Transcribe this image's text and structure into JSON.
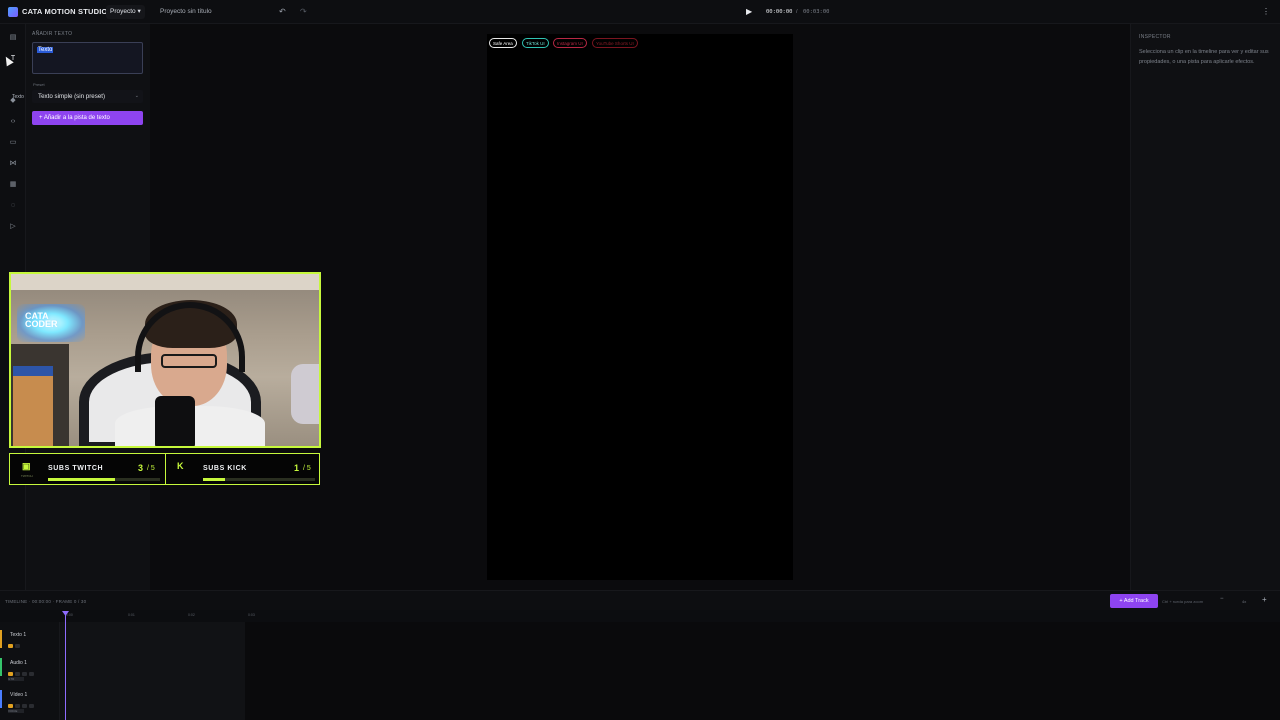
{
  "app": {
    "title": "CATA MOTION STUDIO"
  },
  "menu": {
    "proyecto": "Proyecto ▾",
    "project_name": "Proyecto sin título"
  },
  "transport": {
    "time_current": "00:00:00",
    "sep": "/",
    "time_total": "00:03:00"
  },
  "left_panel": {
    "heading": "AÑADIR TEXTO",
    "text_value": "Texto",
    "tooltip": "Texto",
    "preset_label": "Preset",
    "preset_value": "Texto simple (sin preset)",
    "add_button": "+ Añadir a la pista de texto"
  },
  "canvas": {
    "pills": [
      "Safe Area",
      "TikTok UI",
      "Instagram UI",
      "YouTube Shorts UI"
    ]
  },
  "webcam": {
    "sign_text": "CATA\nCODER"
  },
  "subs": {
    "twitch": {
      "label": "SUBS TWITCH",
      "count": "3",
      "total": "/ 5",
      "progress": 0.6
    },
    "kick": {
      "label": "SUBS KICK",
      "count": "1",
      "total": "/ 5",
      "progress": 0.2
    }
  },
  "inspector": {
    "title": "INSPECTOR",
    "hint": "Selecciona un clip en la timeline para ver y editar sus propiedades, o una pista para aplicarle efectos."
  },
  "timeline": {
    "label": "TIMELINE · 00:00:00 · FRAME 0 / 30",
    "add_track": "+ Add Track",
    "zoom_hint": "Ctrl + rueda para zoom",
    "zoom_value": "4x",
    "ruler": [
      "0:00",
      "0:01",
      "0:02",
      "0:03"
    ],
    "tracks": [
      {
        "name": "Texto 1",
        "color": "#e0a020",
        "sub": ""
      },
      {
        "name": "Audio 1",
        "color": "#35c46b",
        "sub": "GTR"
      },
      {
        "name": "Vídeo 1",
        "color": "#4a7dff",
        "sub": "VOICE"
      }
    ]
  },
  "colors": {
    "accent": "#8e44f0",
    "neon": "#c6f83c"
  },
  "icons": [
    "layers-icon",
    "text-icon",
    "shapes-icon",
    "code-icon",
    "comment-icon",
    "transition-icon",
    "grid-icon",
    "effects-icon",
    "play-icon"
  ]
}
